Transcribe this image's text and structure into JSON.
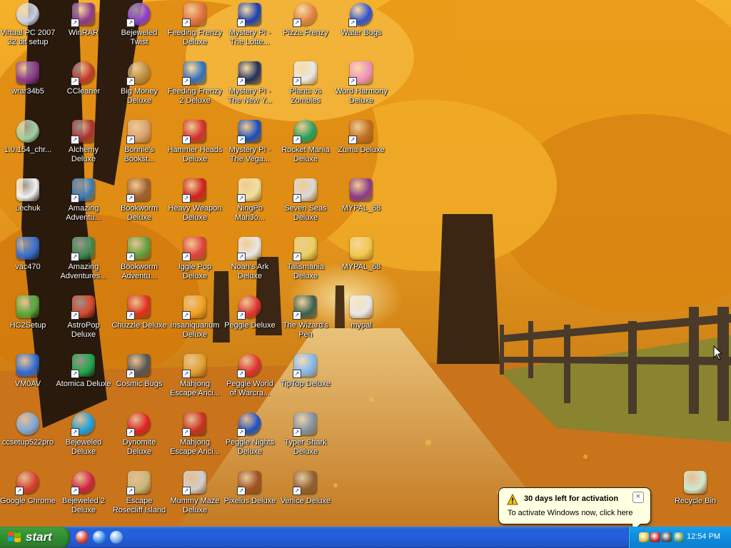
{
  "desktop": {
    "icons": [
      {
        "label": "Virtual PC 2007 32 bit setup",
        "icon": "cd-installer-icon",
        "color": "#c8cfe0"
      },
      {
        "label": "wrar34b5",
        "icon": "winrar-archive-icon",
        "color": "#8b3a8b"
      },
      {
        "label": "1.0.154_chr...",
        "icon": "installer-cd-icon",
        "color": "#9fcf9f"
      },
      {
        "label": "Lechuk",
        "icon": "document-icon",
        "color": "#f2f2f2"
      },
      {
        "label": "vac470",
        "icon": "setup-icon",
        "color": "#3a6ed0"
      },
      {
        "label": "HC2Setup",
        "icon": "setup-box-icon",
        "color": "#5aa83a"
      },
      {
        "label": "VM0AV",
        "icon": "security-shield-icon",
        "color": "#2f6bd6"
      },
      {
        "label": "ccsetup522pro",
        "icon": "ccleaner-setup-icon",
        "color": "#7aa6d8"
      },
      {
        "label": "Google Chrome",
        "icon": "chrome-icon",
        "color": "#d33b2c"
      },
      {
        "label": "WinRAR",
        "icon": "winrar-icon",
        "color": "#8b3a8b"
      },
      {
        "label": "CCleaner",
        "icon": "ccleaner-icon",
        "color": "#c0392b"
      },
      {
        "label": "Alchemy Deluxe",
        "icon": "alchemy-icon",
        "color": "#a83232"
      },
      {
        "label": "Amazing Adventu...",
        "icon": "amazing-adventures-icon",
        "color": "#3b7bb5"
      },
      {
        "label": "Amazing Adventures...",
        "icon": "amazing-adventures-2-icon",
        "color": "#3b8a4e"
      },
      {
        "label": "AstroPop Deluxe",
        "icon": "astropop-icon",
        "color": "#d8452a"
      },
      {
        "label": "Atomica Deluxe",
        "icon": "atomica-icon",
        "color": "#1fa84a"
      },
      {
        "label": "Bejeweled Deluxe",
        "icon": "bejeweled-icon",
        "color": "#1aa0e0"
      },
      {
        "label": "Bejeweled 2 Deluxe",
        "icon": "bejeweled-2-icon",
        "color": "#d02040"
      },
      {
        "label": "Bejeweled Twist",
        "icon": "bejeweled-twist-icon",
        "color": "#8a3cd0"
      },
      {
        "label": "Big Money Deluxe",
        "icon": "money-bag-icon",
        "color": "#b88a3a"
      },
      {
        "label": "Bonnie's Bookst...",
        "icon": "bonnie-bookstore-icon",
        "color": "#d8a070"
      },
      {
        "label": "Bookworm Deluxe",
        "icon": "bookworm-icon",
        "color": "#a06030"
      },
      {
        "label": "Bookworm Adventu...",
        "icon": "bookworm-adventures-icon",
        "color": "#60a040"
      },
      {
        "label": "Chuzzle Deluxe",
        "icon": "chuzzle-icon",
        "color": "#e03020"
      },
      {
        "label": "Cosmic Bugs",
        "icon": "cosmic-bugs-icon",
        "color": "#555555"
      },
      {
        "label": "Dynomite Deluxe",
        "icon": "dynomite-egg-icon",
        "color": "#e02020"
      },
      {
        "label": "Escape Rosecliff Island",
        "icon": "escape-rosecliff-icon",
        "color": "#c8b878"
      },
      {
        "label": "Feeding Frenzy Deluxe",
        "icon": "feeding-frenzy-icon",
        "color": "#e07040"
      },
      {
        "label": "Feeding Frenzy 2 Deluxe",
        "icon": "feeding-frenzy-2-icon",
        "color": "#3070c0"
      },
      {
        "label": "Hammer Heads Deluxe",
        "icon": "hammer-heads-icon",
        "color": "#d03030"
      },
      {
        "label": "Heavy Weapon Deluxe",
        "icon": "heavy-weapon-icon",
        "color": "#d02020"
      },
      {
        "label": "Iggle Pop Deluxe",
        "icon": "iggle-pop-icon",
        "color": "#e04040"
      },
      {
        "label": "Insaniquarium Deluxe",
        "icon": "insaniquarium-icon",
        "color": "#f0a020"
      },
      {
        "label": "Mahjong Escape Anci...",
        "icon": "mahjong-escape-icon",
        "color": "#e0a030"
      },
      {
        "label": "Mahjong Escape Anci...",
        "icon": "mahjong-escape-2-icon",
        "color": "#c83020"
      },
      {
        "label": "Mummy Maze Deluxe",
        "icon": "mummy-maze-icon",
        "color": "#cfcfcf"
      },
      {
        "label": "Mystery PI - The Lotte...",
        "icon": "mystery-pi-icon",
        "color": "#1a3fb0"
      },
      {
        "label": "Mystery PI - The New Y...",
        "icon": "mystery-pi-newyork-icon",
        "color": "#203060"
      },
      {
        "label": "Mystery PI - The Vega...",
        "icon": "mystery-pi-vegas-icon",
        "color": "#1a4fc0"
      },
      {
        "label": "NingPo MahJo...",
        "icon": "ningpo-mahjong-icon",
        "color": "#f0e0a0"
      },
      {
        "label": "Noah's Ark Deluxe",
        "icon": "noahs-ark-dove-icon",
        "color": "#e8e8e8"
      },
      {
        "label": "Peggle Deluxe",
        "icon": "peggle-icon",
        "color": "#e03030"
      },
      {
        "label": "Peggle World of Warcra...",
        "icon": "peggle-wow-icon",
        "color": "#e03030"
      },
      {
        "label": "Peggle Nights Deluxe",
        "icon": "peggle-nights-icon",
        "color": "#2050c0"
      },
      {
        "label": "Pixelus Deluxe",
        "icon": "pixelus-icon",
        "color": "#a05020"
      },
      {
        "label": "Pizza Frenzy",
        "icon": "pizza-icon",
        "color": "#e08040"
      },
      {
        "label": "Plants vs Zombies",
        "icon": "plants-vs-zombies-icon",
        "color": "#e8e8e8"
      },
      {
        "label": "Rocket Mania Deluxe",
        "icon": "rocket-mania-icon",
        "color": "#20a060"
      },
      {
        "label": "Seven Seas Deluxe",
        "icon": "seven-seas-skull-icon",
        "color": "#d8d8d8"
      },
      {
        "label": "Talismania Deluxe",
        "icon": "talismania-icon",
        "color": "#e8d060"
      },
      {
        "label": "The Wizard's Pen",
        "icon": "wizards-pen-icon",
        "color": "#3a6050"
      },
      {
        "label": "TipTop Deluxe",
        "icon": "tiptop-cocktail-icon",
        "color": "#80b8f0"
      },
      {
        "label": "Typer Shark Deluxe",
        "icon": "typer-shark-icon",
        "color": "#8090a0"
      },
      {
        "label": "Venice Deluxe",
        "icon": "venice-icon",
        "color": "#906030"
      },
      {
        "label": "Water Bugs",
        "icon": "water-bugs-icon",
        "color": "#3050d0"
      },
      {
        "label": "Word Harmony Deluxe",
        "icon": "word-harmony-flower-icon",
        "color": "#f090c0"
      },
      {
        "label": "Zuma Deluxe",
        "icon": "zuma-icon",
        "color": "#c07020"
      },
      {
        "label": "MYPAL_68",
        "icon": "winrar-archive-icon",
        "color": "#8b3a8b"
      },
      {
        "label": "MYPAL_68",
        "icon": "folder-icon",
        "color": "#f0c850"
      },
      {
        "label": "mypal",
        "icon": "mypal-icon",
        "color": "#e8e8e8"
      },
      {
        "label": "Recycle Bin",
        "icon": "recycle-bin-icon",
        "color": "#d0e8d0"
      }
    ]
  },
  "balloon": {
    "title": "30 days left for activation",
    "body": "To activate Windows now, click here",
    "close_glyph": "×"
  },
  "taskbar": {
    "start_label": "start",
    "quicklaunch": [
      {
        "icon": "chrome-icon",
        "color": "#d33b2c"
      },
      {
        "icon": "internet-explorer-icon",
        "color": "#3a8ee6"
      },
      {
        "icon": "show-desktop-icon",
        "color": "#6fa8e8"
      }
    ],
    "tray_icons": [
      {
        "icon": "network-icon",
        "color": "#e8c030"
      },
      {
        "icon": "security-alert-icon",
        "color": "#d02020"
      },
      {
        "icon": "antivirus-shield-icon",
        "color": "#555555"
      },
      {
        "icon": "activation-key-icon",
        "color": "#60a060"
      }
    ],
    "clock": "12:54 PM"
  }
}
